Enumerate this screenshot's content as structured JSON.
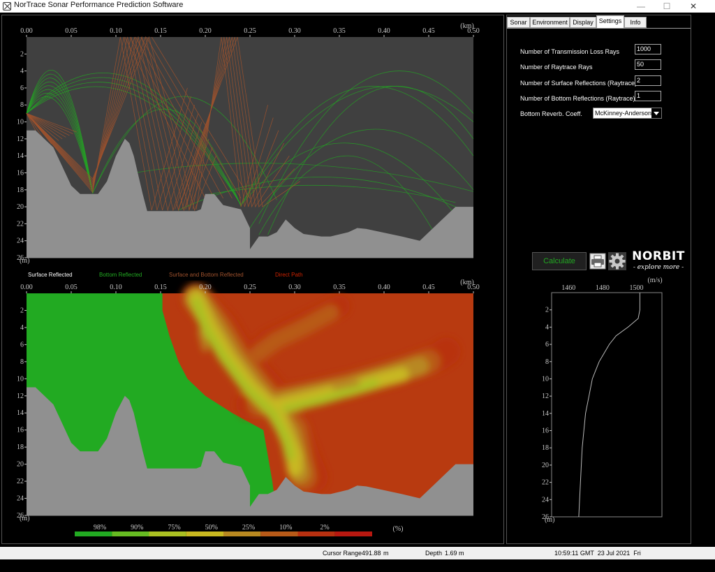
{
  "window": {
    "title": "NorTrace Sonar Performance Prediction Software",
    "minimize_glyph": "—",
    "maximize_glyph": "☐",
    "close_glyph": "✕"
  },
  "tabs": [
    {
      "label": "Sonar"
    },
    {
      "label": "Environment"
    },
    {
      "label": "Display"
    },
    {
      "label": "Settings",
      "active": true
    },
    {
      "label": "Info"
    }
  ],
  "settings": {
    "tl_rays_label": "Number of Transmission Loss Rays",
    "tl_rays_value": "1000",
    "raytrace_rays_label": "Number of Raytrace Rays",
    "raytrace_rays_value": "50",
    "surface_refl_label": "Number of Surface Reflections (Raytrace)",
    "surface_refl_value": "2",
    "bottom_refl_label": "Number of Bottom Reflections (Raytrace)",
    "bottom_refl_value": "1",
    "reverb_label": "Bottom Reverb. Coeff.",
    "reverb_value": "McKinney-Anderson"
  },
  "actions": {
    "calculate_label": "Calculate"
  },
  "logo": {
    "name": "NORBIT",
    "tagline": "- explore more -"
  },
  "axes": {
    "range_unit": "(km)",
    "depth_unit": "(m)",
    "range_ticks": [
      "0.00",
      "0.05",
      "0.10",
      "0.15",
      "0.20",
      "0.25",
      "0.30",
      "0.35",
      "0.40",
      "0.45",
      "0.50"
    ],
    "depth_ticks": [
      "2",
      "4",
      "6",
      "8",
      "10",
      "12",
      "14",
      "16",
      "18",
      "20",
      "22",
      "24",
      "26"
    ],
    "sv_unit": "(m/s)",
    "sv_ticks": [
      "1460",
      "1480",
      "1500"
    ]
  },
  "legend": {
    "surface": "Surface Reflected",
    "bottom": "Bottom Reflected",
    "both": "Surface and Bottom Reflected",
    "direct": "Direct Path"
  },
  "colorbar": {
    "labels": [
      "98%",
      "90%",
      "75%",
      "50%",
      "25%",
      "10%",
      "2%"
    ],
    "unit": "(%)",
    "colors": [
      "#22aa22",
      "#66bb22",
      "#aac022",
      "#c8b820",
      "#b88820",
      "#b85a18",
      "#b83010",
      "#b81810"
    ]
  },
  "colors": {
    "surface_rays": "#ffffff",
    "bottom_rays": "#22aa22",
    "both_rays": "#a0522d",
    "direct_rays": "#cc2200",
    "seabed": "#909090",
    "water": "#404040",
    "tl_low": "#22aa22",
    "tl_high": "#b83a10"
  },
  "status": {
    "cursor_range_label": "Cursor Range",
    "cursor_range_value": "491.88",
    "cursor_range_unit": "m",
    "depth_label": "Depth",
    "depth_value": "1.69",
    "depth_unit": "m",
    "datetime": "10:59:11 GMT  23 Jul 2021  Fri"
  },
  "chart_data": [
    {
      "type": "line",
      "xlabel": "(km)",
      "ylabel": "(m)",
      "xlim": [
        0,
        0.5
      ],
      "ylim": [
        26,
        0
      ],
      "source_depth": 9,
      "seabed": {
        "x": [
          0,
          0.01,
          0.03,
          0.05,
          0.06,
          0.08,
          0.09,
          0.1,
          0.11,
          0.115,
          0.12,
          0.13,
          0.135,
          0.14,
          0.16,
          0.19,
          0.195,
          0.2,
          0.21,
          0.22,
          0.24,
          0.25,
          0.25,
          0.26,
          0.27,
          0.28,
          0.29,
          0.3,
          0.31,
          0.33,
          0.34,
          0.36,
          0.37,
          0.38,
          0.42,
          0.44,
          0.46,
          0.48,
          0.5
        ],
        "y": [
          11,
          11,
          13,
          17.5,
          18.5,
          18.5,
          17,
          14,
          12,
          12.5,
          14,
          18.5,
          20.5,
          20.5,
          20.5,
          20.5,
          20.3,
          18.5,
          18.5,
          19.8,
          20.3,
          22.5,
          25,
          23.5,
          23.5,
          23,
          21.5,
          22.5,
          23.2,
          23.5,
          23.5,
          23,
          22.5,
          22.6,
          23.5,
          24,
          22,
          20,
          20
        ]
      }
    },
    {
      "type": "heatmap",
      "xlabel": "(km)",
      "ylabel": "(m)",
      "xlim": [
        0,
        0.5
      ],
      "ylim": [
        26,
        0
      ],
      "zlabel": "(%)",
      "levels": [
        "98%",
        "90%",
        "75%",
        "50%",
        "25%",
        "10%",
        "2%"
      ]
    },
    {
      "type": "line",
      "xlabel": "(m/s)",
      "ylabel": "(m)",
      "xlim": [
        1450,
        1515
      ],
      "ylim": [
        26,
        0
      ],
      "x": [
        1502,
        1502,
        1501,
        1495,
        1488,
        1484,
        1481,
        1478,
        1476,
        1474,
        1472,
        1470,
        1469,
        1468,
        1467,
        1466
      ],
      "y": [
        0,
        2,
        3,
        4,
        5,
        6,
        7,
        8,
        9,
        10,
        12,
        14,
        16,
        18,
        22,
        26
      ]
    }
  ]
}
